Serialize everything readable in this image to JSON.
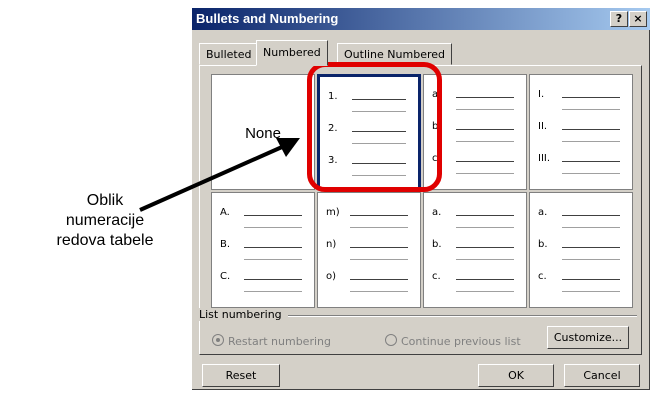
{
  "annotation": {
    "text": "Oblik\nnumeracije\nredova tabele"
  },
  "dialog": {
    "title": "Bullets and Numbering",
    "help_label": "?",
    "close_label": "×",
    "tabs": [
      "Bulleted",
      "Numbered",
      "Outline Numbered"
    ],
    "active_tab": "Numbered"
  },
  "tiles": [
    {
      "none_label": "None",
      "rows": []
    },
    {
      "selected": true,
      "rows": [
        "1.",
        "2.",
        "3."
      ]
    },
    {
      "rows": [
        "a.",
        "b.",
        "c."
      ]
    },
    {
      "rows": [
        "I.",
        "II.",
        "III."
      ]
    },
    {
      "rows": [
        "A.",
        "B.",
        "C."
      ]
    },
    {
      "rows": [
        "m)",
        "n)",
        "o)"
      ]
    },
    {
      "rows": [
        "a.",
        "b.",
        "c."
      ]
    },
    {
      "rows": [
        "a.",
        "b.",
        "c."
      ]
    }
  ],
  "list_numbering": {
    "label": "List numbering",
    "restart_label": "Restart numbering",
    "continue_label": "Continue previous list"
  },
  "buttons": {
    "customize": "Customize...",
    "reset": "Reset",
    "ok": "OK",
    "cancel": "Cancel"
  },
  "colors": {
    "highlight": "#e00000",
    "title_bar": "#0a246a"
  }
}
